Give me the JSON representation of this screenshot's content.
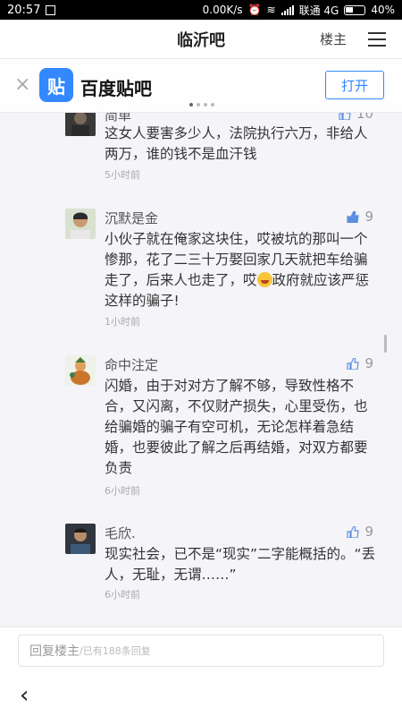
{
  "statusbar": {
    "time": "20:57",
    "speed": "0.00K/s",
    "carrier": "联通 4G",
    "battery": "40%"
  },
  "navbar": {
    "title": "临沂吧",
    "owner_label": "楼主"
  },
  "banner": {
    "logo_text": "贴",
    "app_name": "百度贴吧",
    "open_label": "打开",
    "close_label": "×"
  },
  "comments": [
    {
      "user": "简单",
      "likes": "10",
      "text": "这女人要害多少人，法院执行六万，非给人两万，谁的钱不是血汗钱",
      "time": "5小时前"
    },
    {
      "user": "沉默是金",
      "likes": "9",
      "text_before": "小伙子就在俺家这块住，哎被坑的那叫一个惨那，花了二三十万娶回家几天就把车给骗走了，后来人也走了，哎",
      "text_after": "政府就应该严惩这样的骗子!",
      "time": "1小时前"
    },
    {
      "user": "命中注定",
      "likes": "9",
      "text": "闪婚，由于对对方了解不够，导致性格不合，又闪离，不仅财产损失，心里受伤，也给骗婚的骗子有空可机，无论怎样着急结婚，也要彼此了解之后再结婚，对双方都要负责",
      "time": "6小时前"
    },
    {
      "user": "毛欣.",
      "likes": "9",
      "text": "现实社会，已不是“现实”二字能概括的。“丢人，无耻，无谓……”",
      "time": "6小时前"
    }
  ],
  "reply": {
    "placeholder": "回复楼主",
    "count_text": "/已有188条回复"
  },
  "colors": {
    "accent": "#3388ff"
  }
}
